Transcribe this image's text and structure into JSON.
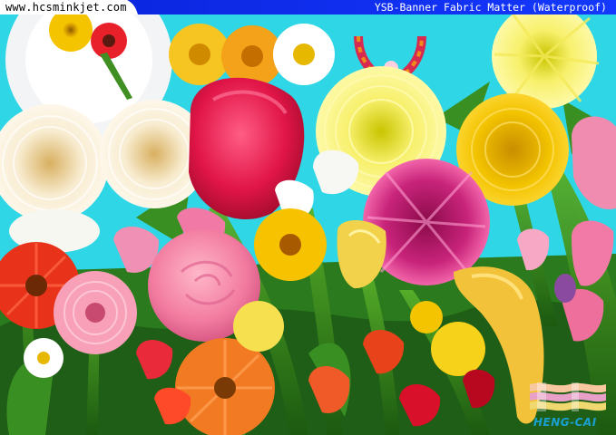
{
  "header": {
    "site_url": "www.hcsminkjet.com",
    "banner_title": "YSB-Banner Fabric Matter (Waterproof)"
  },
  "brand": {
    "logo_text": "HENG-CAI"
  },
  "colors": {
    "background_cyan": "#2fd6e6",
    "header_blue": "#0a22d8",
    "logo_blue": "#1aa0d0"
  }
}
